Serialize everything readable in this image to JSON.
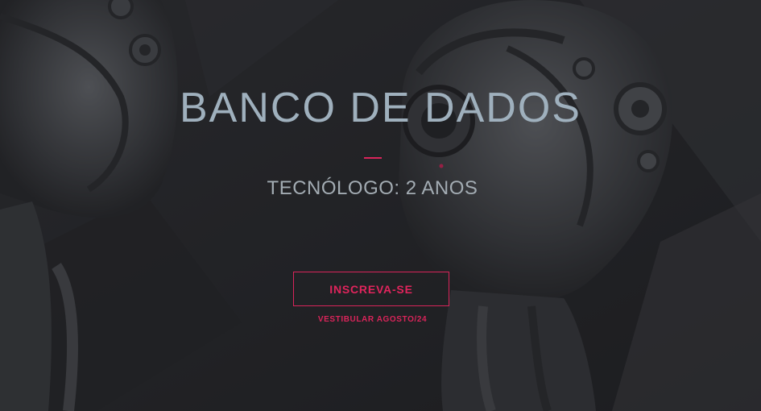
{
  "hero": {
    "title": "BANCO DE DADOS",
    "subtitle": "TECNÓLOGO: 2 ANOS",
    "cta_label": "INSCREVA-SE",
    "note": "VESTIBULAR AGOSTO/24",
    "background_image": "robot-heads-illustration"
  },
  "colors": {
    "background": "#2b2c2f",
    "title": "#9fb0bd",
    "subtitle": "#a3acb3",
    "accent": "#d9245a"
  }
}
